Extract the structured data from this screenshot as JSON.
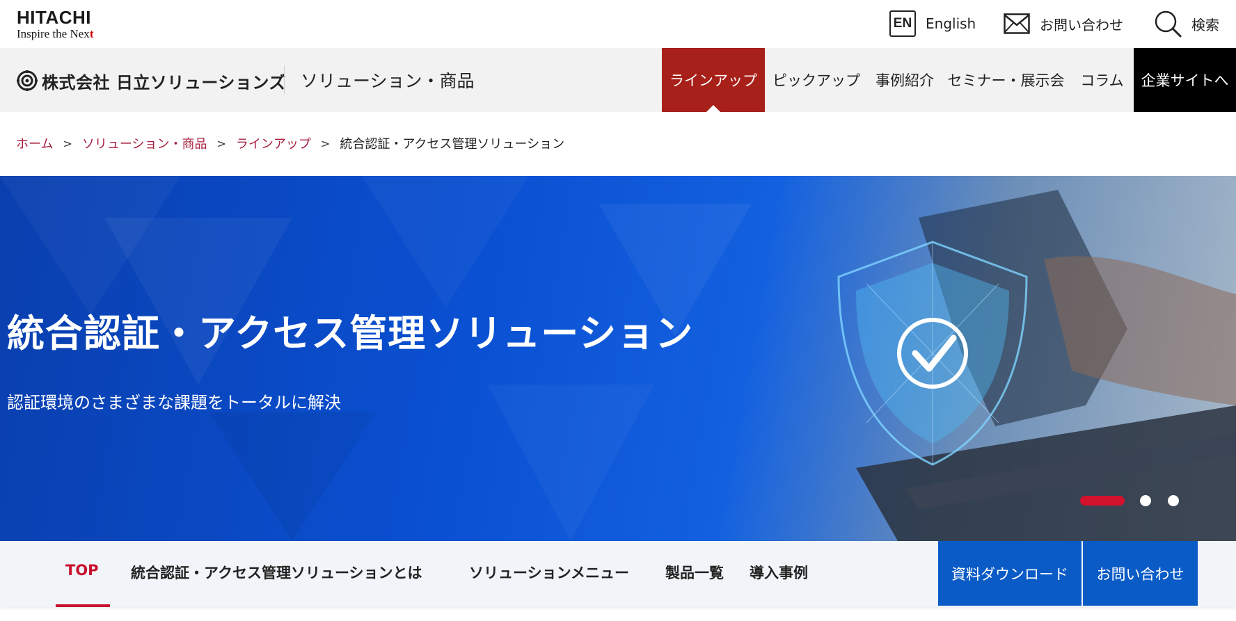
{
  "header": {
    "logo_brand": "HITACHI",
    "logo_tagline_prefix": "Inspire the Nex",
    "logo_tagline_last": "t",
    "english_badge": "EN",
    "english_label": "English",
    "contact_label": "お問い合わせ",
    "search_label": "検索"
  },
  "mainbar": {
    "company_name": "株式会社 日立ソリューションズ",
    "section_title": "ソリューション・商品",
    "nav": [
      {
        "label": "ラインアップ",
        "active": true
      },
      {
        "label": "ピックアップ"
      },
      {
        "label": "事例紹介"
      },
      {
        "label": "セミナー・展示会"
      },
      {
        "label": "コラム"
      },
      {
        "label": "企業サイトへ"
      }
    ]
  },
  "breadcrumb": {
    "items": [
      "ホーム",
      "ソリューション・商品",
      "ラインアップ"
    ],
    "separator": ">",
    "current": "統合認証・アクセス管理ソリューション"
  },
  "hero": {
    "title": "統合認証・アクセス管理ソリューション",
    "subtitle": "認証環境のさまざまな課題をトータルに解決",
    "slide_count": 3,
    "active_slide": 1
  },
  "subnav": {
    "tabs": [
      "TOP",
      "統合認証・アクセス管理ソリューションとは",
      "ソリューションメニュー",
      "製品一覧",
      "導入事例"
    ],
    "active_tab": "TOP",
    "buttons": [
      "資料ダウンロード",
      "お問い合わせ"
    ]
  },
  "colors": {
    "accent_red": "#a8201a",
    "brand_red": "#c8102e",
    "link_red": "#a8203f",
    "button_blue": "#0b5bc7",
    "hero_blue": "#0a50d2"
  }
}
